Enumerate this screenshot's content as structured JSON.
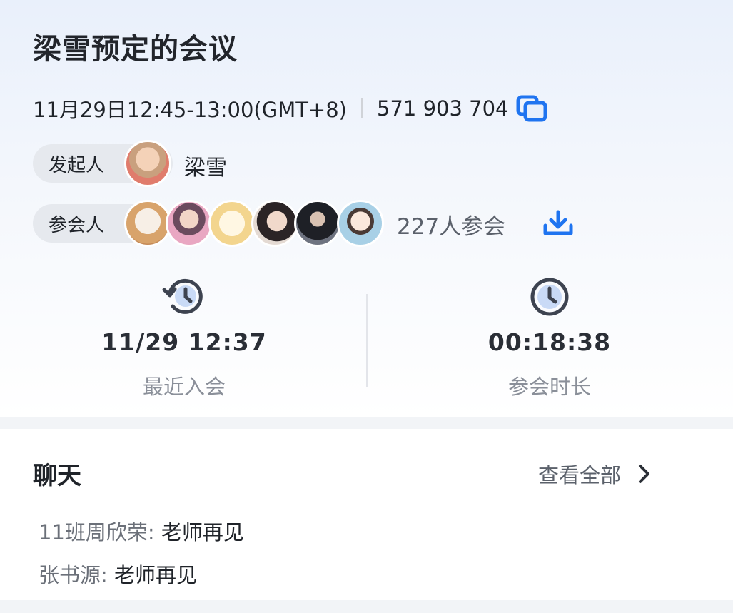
{
  "meeting": {
    "title": "梁雪预定的会议",
    "time": "11月29日12:45-13:00(GMT+8)",
    "meeting_id": "571 903 704"
  },
  "organizer": {
    "label": "发起人",
    "name": "梁雪"
  },
  "participants": {
    "label": "参会人",
    "count_text": "227人参会"
  },
  "stats": {
    "last_join": {
      "value": "11/29 12:37",
      "label": "最近入会"
    },
    "duration": {
      "value": "00:18:38",
      "label": "参会时长"
    }
  },
  "chat": {
    "title": "聊天",
    "view_all": "查看全部",
    "messages": [
      {
        "sender": "11班周欣荣:",
        "text": "老师再见"
      },
      {
        "sender": "张书源:",
        "text": "老师再见"
      }
    ]
  },
  "colors": {
    "accent": "#1f74f0",
    "icon_dark": "#3d4350"
  },
  "icons": [
    "copy-icon",
    "download-icon",
    "history-clock-icon",
    "clock-icon",
    "chevron-right-icon"
  ]
}
